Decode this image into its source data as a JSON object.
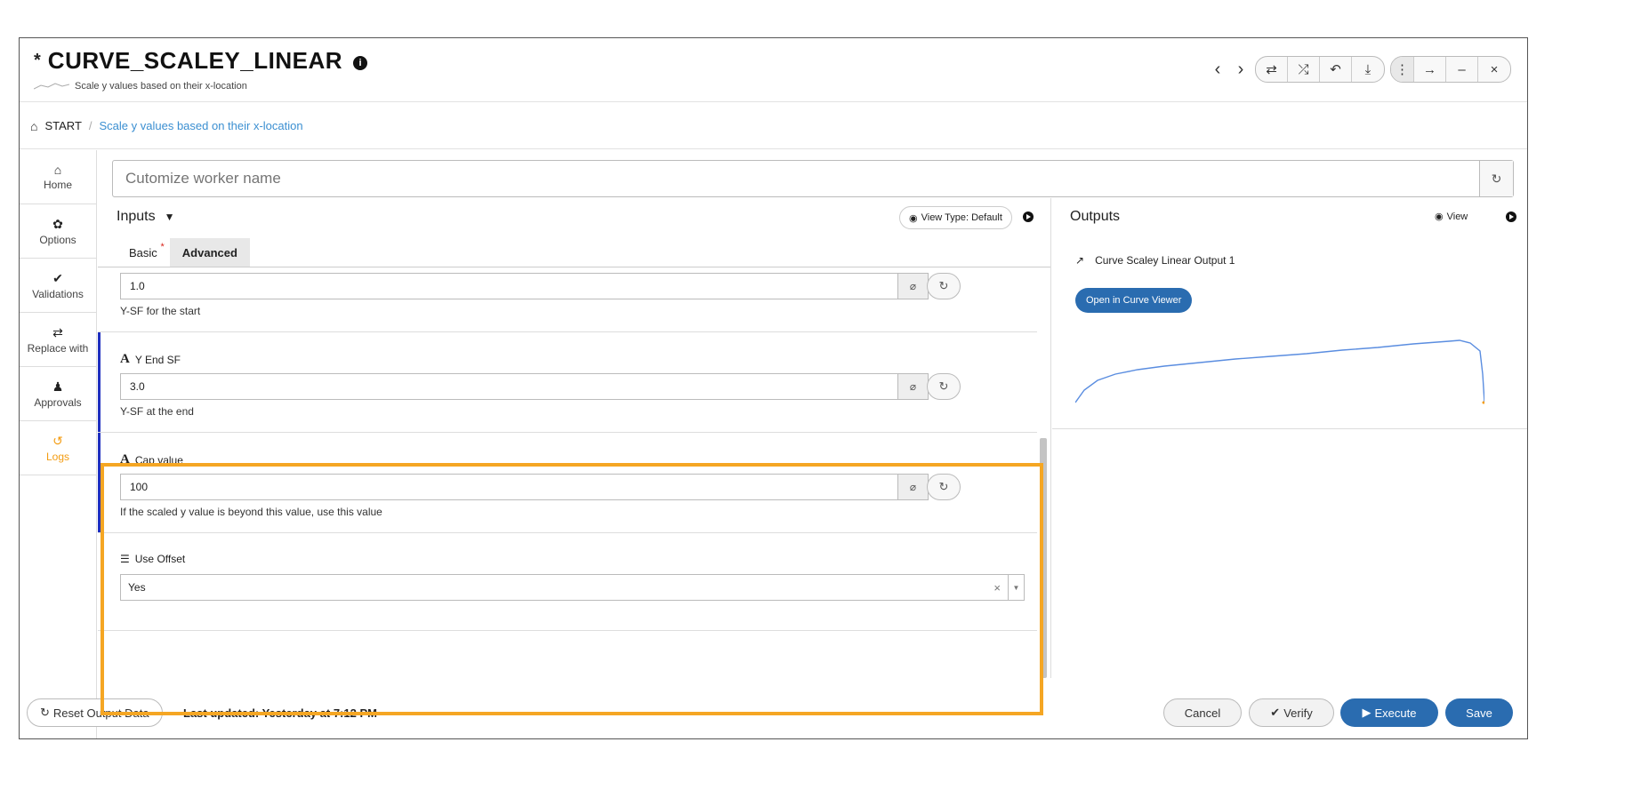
{
  "header": {
    "modified_marker": "*",
    "title": "CURVE_SCALEY_LINEAR",
    "info_glyph": "i",
    "subtitle": "Scale y values based on their x-location"
  },
  "window_controls": {
    "prev": "‹",
    "next": "›",
    "group1": [
      "⇄",
      "⤮",
      "↶",
      "⤓"
    ],
    "kebab": "⋮",
    "group2": [
      "→",
      "–",
      "×"
    ]
  },
  "breadcrumb": {
    "home_icon": "home-icon",
    "start": "START",
    "separator": "/",
    "current": "Scale y values based on their x-location"
  },
  "sidebar": {
    "items": [
      {
        "id": "home",
        "icon": "⌂",
        "label": "Home"
      },
      {
        "id": "options",
        "icon": "✿",
        "label": "Options"
      },
      {
        "id": "validations",
        "icon": "✔",
        "label": "Validations"
      },
      {
        "id": "replace",
        "icon": "⇄",
        "label": "Replace with"
      },
      {
        "id": "approvals",
        "icon": "♟",
        "label": "Approvals"
      },
      {
        "id": "logs",
        "icon": "↺",
        "label": "Logs"
      }
    ]
  },
  "worker": {
    "placeholder": "Cutomize worker name",
    "value": ""
  },
  "inputs": {
    "title": "Inputs",
    "view_type": "View Type: Default",
    "tabs": [
      {
        "label": "Basic",
        "required_mark": "*"
      },
      {
        "label": "Advanced"
      }
    ],
    "fields": [
      {
        "value": "1.0",
        "help": "Y-SF for the start"
      },
      {
        "label": "Y End SF",
        "value": "3.0",
        "help": "Y-SF at the end"
      },
      {
        "label": "Cap value",
        "value": "100",
        "help": "If the scaled y value is beyond this value, use this value"
      },
      {
        "label": "Use Offset",
        "value": "Yes"
      }
    ]
  },
  "outputs": {
    "title": "Outputs",
    "view_label": "View",
    "item_label": "Curve Scaley Linear Output 1",
    "open_button": "Open in Curve Viewer"
  },
  "footer": {
    "reset_button": "Reset Output Data",
    "last_updated": "Last updated: Yesterday at 7:12 PM",
    "cancel": "Cancel",
    "verify": "Verify",
    "execute": "Execute",
    "save": "Save"
  },
  "colors": {
    "accent_blue": "#2a6cb0",
    "active_orange": "#f39c12",
    "highlight": "#f5a623",
    "field_accent": "#1f2fbf"
  }
}
